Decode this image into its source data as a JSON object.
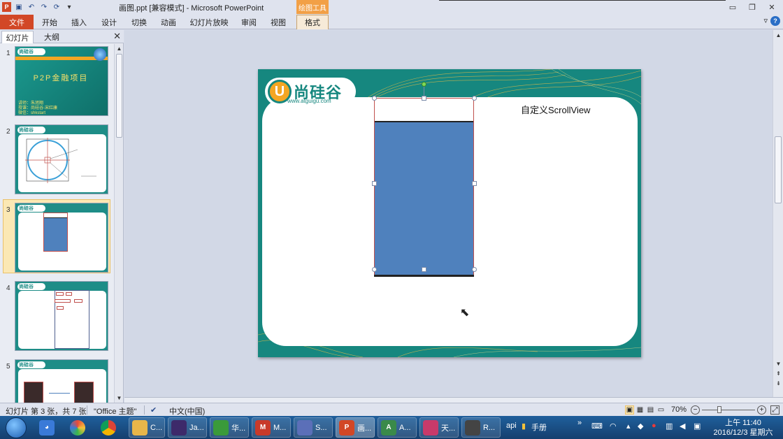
{
  "titlebar": {
    "title": "画图.ppt [兼容模式]  -  Microsoft PowerPoint",
    "context_tab_header": "绘图工具",
    "app_icon": "P",
    "quick_access": [
      "save-icon",
      "undo-icon",
      "redo-icon",
      "repeat-icon",
      "customize-icon"
    ],
    "window_buttons": [
      "minimize-icon",
      "restore-icon",
      "close-icon"
    ]
  },
  "ribbon": {
    "tabs": [
      "文件",
      "开始",
      "插入",
      "设计",
      "切换",
      "动画",
      "幻灯片放映",
      "审阅",
      "视图",
      "格式"
    ]
  },
  "left_panel": {
    "tabs": [
      "幻灯片",
      "大纲"
    ],
    "close_label": "✕",
    "thumbnails": [
      {
        "num": "1",
        "title": "P2P金融项目",
        "credits": "讲师：朱旭翔\n授课：尚硅谷-宋红康\n微信：shkstart"
      },
      {
        "num": "2"
      },
      {
        "num": "3"
      },
      {
        "num": "4"
      },
      {
        "num": "5"
      }
    ],
    "logo_text": "尚硅谷"
  },
  "slide": {
    "logo_letter": "U",
    "logo_text": "尚硅谷",
    "logo_url": "www.atguigu.com",
    "heading": "自定义ScrollView"
  },
  "statusbar": {
    "slide_info": "幻灯片 第 3 张，共 7 张",
    "theme": "\"Office 主题\"",
    "language": "中文(中国)",
    "zoom": "70%"
  },
  "taskbar": {
    "items": [
      {
        "label": "C...",
        "icon": "folder-icon",
        "color": "#e8b64a"
      },
      {
        "label": "Ja...",
        "icon": "eclipse-icon",
        "color": "#3d2a6a"
      },
      {
        "label": "华...",
        "icon": "app-icon",
        "color": "#3a9a3a"
      },
      {
        "label": "M...",
        "icon": "m-icon",
        "color": "#c83a2a"
      },
      {
        "label": "S...",
        "icon": "dolphin-icon",
        "color": "#5b6fb8"
      },
      {
        "label": "画...",
        "icon": "powerpoint-icon",
        "color": "#d24726"
      },
      {
        "label": "A...",
        "icon": "android-studio-icon",
        "color": "#3a8a4a"
      },
      {
        "label": "天...",
        "icon": "bug-icon",
        "color": "#c83a6a"
      },
      {
        "label": "R...",
        "icon": "recorder-icon",
        "color": "#444"
      }
    ],
    "api_label": "api",
    "manual_label": "手册",
    "clock_time": "上午 11:40",
    "clock_date": "2016/12/3 星期六"
  },
  "colors": {
    "accent": "#d24726",
    "slide_teal": "#16877f",
    "shape_blue": "#4f81bd",
    "shape_border": "#c0504d"
  }
}
